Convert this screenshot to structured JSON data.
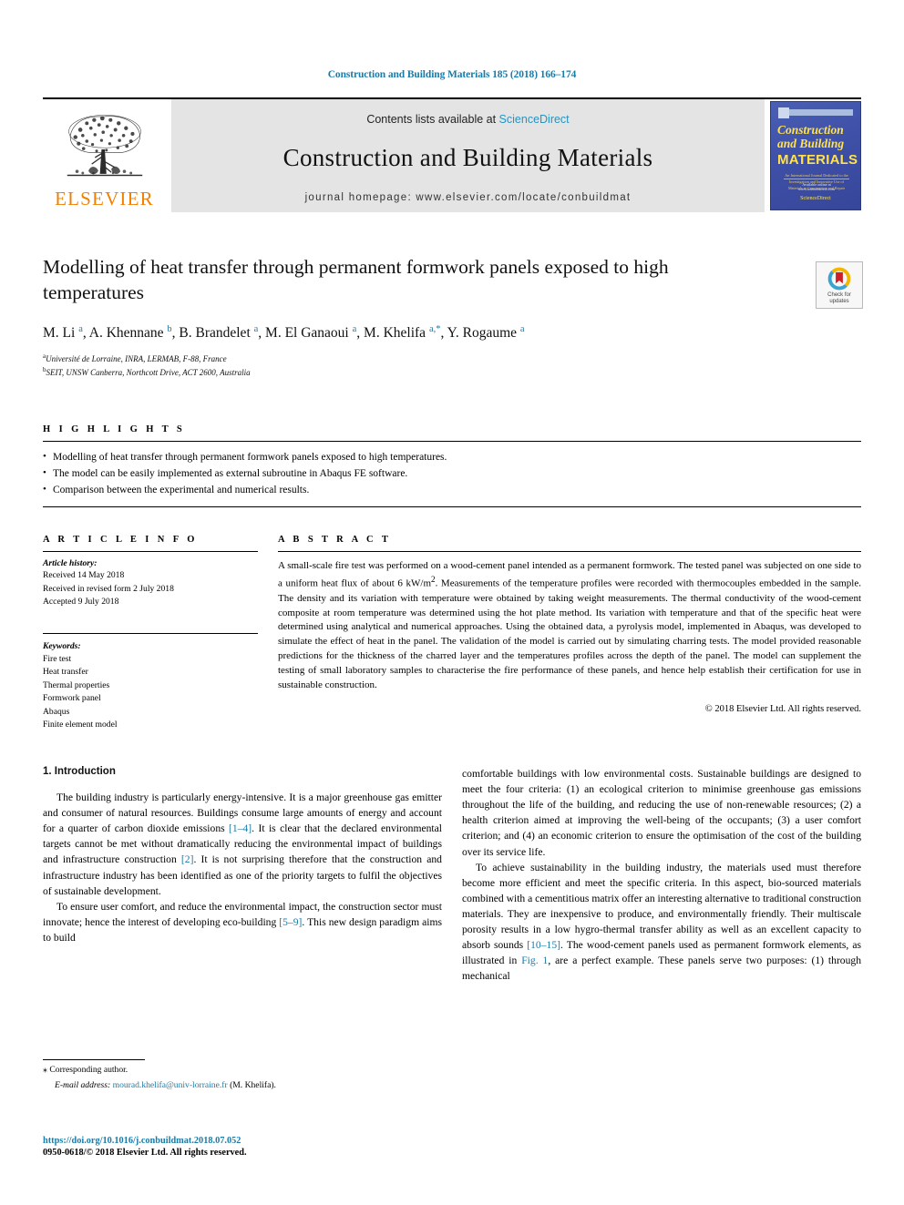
{
  "running_head": "Construction and Building Materials 185 (2018) 166–174",
  "masthead": {
    "contents_prefix": "Contents lists available at ",
    "sciencedirect": "ScienceDirect",
    "journal_title": "Construction and Building Materials",
    "homepage": "journal homepage: www.elsevier.com/locate/conbuildmat",
    "publisher_name": "ELSEVIER",
    "cover": {
      "line1": "Construction",
      "line2": "and Building",
      "line3": "MATERIALS",
      "subtitle": "An International Journal Dedicated to the Investigation and Innovative Use of Materials in Construction and Repair",
      "footer": "Available online at www.sciencedirect.com",
      "footer2": "ScienceDirect"
    },
    "accent_blue": "#1a7ba8",
    "elsevier_orange": "#f08000",
    "band_gray": "#e4e4e4"
  },
  "article": {
    "title": "Modelling of heat transfer through permanent formwork panels exposed to high temperatures",
    "authors_html": "M. Li <sup>a</sup>, A. Khennane <sup>b</sup>, B. Brandelet <sup>a</sup>, M. El Ganaoui <sup>a</sup>, M. Khelifa <sup>a,*</sup>, Y. Rogaume <sup>a</sup>",
    "affiliations": [
      "Université de Lorraine, INRA, LERMAB, F-88, France",
      "SEIT, UNSW Canberra, Northcott Drive, ACT 2600, Australia"
    ],
    "affiliation_marks": [
      "a",
      "b"
    ],
    "crossmark_label_line1": "Check for",
    "crossmark_label_line2": "updates"
  },
  "highlights": {
    "heading": "H I G H L I G H T S",
    "items": [
      "Modelling of heat transfer through permanent formwork panels exposed to high temperatures.",
      "The model can be easily implemented as external subroutine in Abaqus FE software.",
      "Comparison between the experimental and numerical results."
    ]
  },
  "article_info": {
    "heading": "A R T I C L E  I N F O",
    "history_title": "Article history:",
    "history": [
      "Received 14 May 2018",
      "Received in revised form 2 July 2018",
      "Accepted 9 July 2018"
    ],
    "keywords_title": "Keywords:",
    "keywords": [
      "Fire test",
      "Heat transfer",
      "Thermal properties",
      "Formwork panel",
      "Abaqus",
      "Finite element model"
    ]
  },
  "abstract": {
    "heading": "A B S T R A C T",
    "text_part1": "A small-scale fire test was performed on a wood-cement panel intended as a permanent formwork. The tested panel was subjected on one side to a uniform heat flux of about 6 kW/m",
    "superscript": "2",
    "text_part2": ". Measurements of the temperature profiles were recorded with thermocouples embedded in the sample. The density and its variation with temperature were obtained by taking weight measurements. The thermal conductivity of the wood-cement composite at room temperature was determined using the hot plate method. Its variation with temperature and that of the specific heat were determined using analytical and numerical approaches. Using the obtained data, a pyrolysis model, implemented in Abaqus, was developed to simulate the effect of heat in the panel. The validation of the model is carried out by simulating charring tests. The model provided reasonable predictions for the thickness of the charred layer and the temperatures profiles across the depth of the panel. The model can supplement the testing of small laboratory samples to characterise the fire performance of these panels, and hence help establish their certification for use in sustainable construction.",
    "copyright": "© 2018 Elsevier Ltd. All rights reserved."
  },
  "introduction": {
    "heading": "1. Introduction",
    "left_para1_a": "The building industry is particularly energy-intensive. It is a major greenhouse gas emitter and consumer of natural resources. Buildings consume large amounts of energy and account for a quarter of carbon dioxide emissions ",
    "ref1": "[1–4]",
    "left_para1_b": ". It is clear that the declared environmental targets cannot be met without dramatically reducing the environmental impact of buildings and infrastructure construction ",
    "ref2": "[2]",
    "left_para1_c": ". It is not surprising therefore that the construction and infrastructure industry has been identified as one of the priority targets to fulfil the objectives of sustainable development.",
    "left_para2_a": "To ensure user comfort, and reduce the environmental impact, the construction sector must innovate; hence the interest of developing eco-building ",
    "ref3": "[5–9]",
    "left_para2_b": ". This new design paradigm aims to build",
    "right_para1": "comfortable buildings with low environmental costs. Sustainable buildings are designed to meet the four criteria: (1) an ecological criterion to minimise greenhouse gas emissions throughout the life of the building, and reducing the use of non-renewable resources; (2) a health criterion aimed at improving the well-being of the occupants; (3) a user comfort criterion; and (4) an economic criterion to ensure the optimisation of the cost of the building over its service life.",
    "right_para2_a": "To achieve sustainability in the building industry, the materials used must therefore become more efficient and meet the specific criteria. In this aspect, bio-sourced materials combined with a cementitious matrix offer an interesting alternative to traditional construction materials. They are inexpensive to produce, and environmentally friendly. Their multiscale porosity results in a low hygro-thermal transfer ability as well as an excellent capacity to absorb sounds ",
    "ref4": "[10–15]",
    "right_para2_b": ". The wood-cement panels used as permanent formwork elements, as illustrated in ",
    "ref5": "Fig. 1",
    "right_para2_c": ", are a perfect example. These panels serve two purposes: (1) through mechanical"
  },
  "footnotes": {
    "corresponding_star": "⁎",
    "corresponding_text": "Corresponding author.",
    "email_label": "E-mail address:",
    "email": "mourad.khelifa@univ-lorraine.fr",
    "email_suffix": "(M. Khelifa).",
    "doi": "https://doi.org/10.1016/j.conbuildmat.2018.07.052",
    "issn": "0950-0618/© 2018 Elsevier Ltd. All rights reserved."
  }
}
